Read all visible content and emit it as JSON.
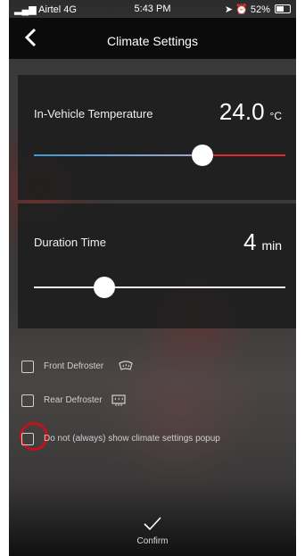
{
  "status": {
    "carrier": "Airtel 4G",
    "time": "5:43 PM",
    "battery": "52%"
  },
  "header": {
    "title": "Climate Settings",
    "back_icon": "chevron-left-icon"
  },
  "temperature": {
    "label": "In-Vehicle Temperature",
    "value": "24.0",
    "unit": "°C",
    "slider_level": 0.67,
    "track_colors": {
      "low": "#3b9ad8",
      "high": "#e0262e"
    }
  },
  "duration": {
    "label": "Duration Time",
    "value": "4",
    "unit": "min",
    "slider_level": 0.28
  },
  "options": [
    {
      "label": "Front Defroster",
      "checked": false,
      "icon": "front-defroster-icon"
    },
    {
      "label": "Rear Defroster",
      "checked": false,
      "icon": "rear-defroster-icon"
    },
    {
      "label": "Do not (always) show climate settings popup",
      "checked": false,
      "highlight_color": "#c0131c"
    }
  ],
  "footer": {
    "confirm_label": "Confirm",
    "confirm_icon": "checkmark-icon"
  }
}
